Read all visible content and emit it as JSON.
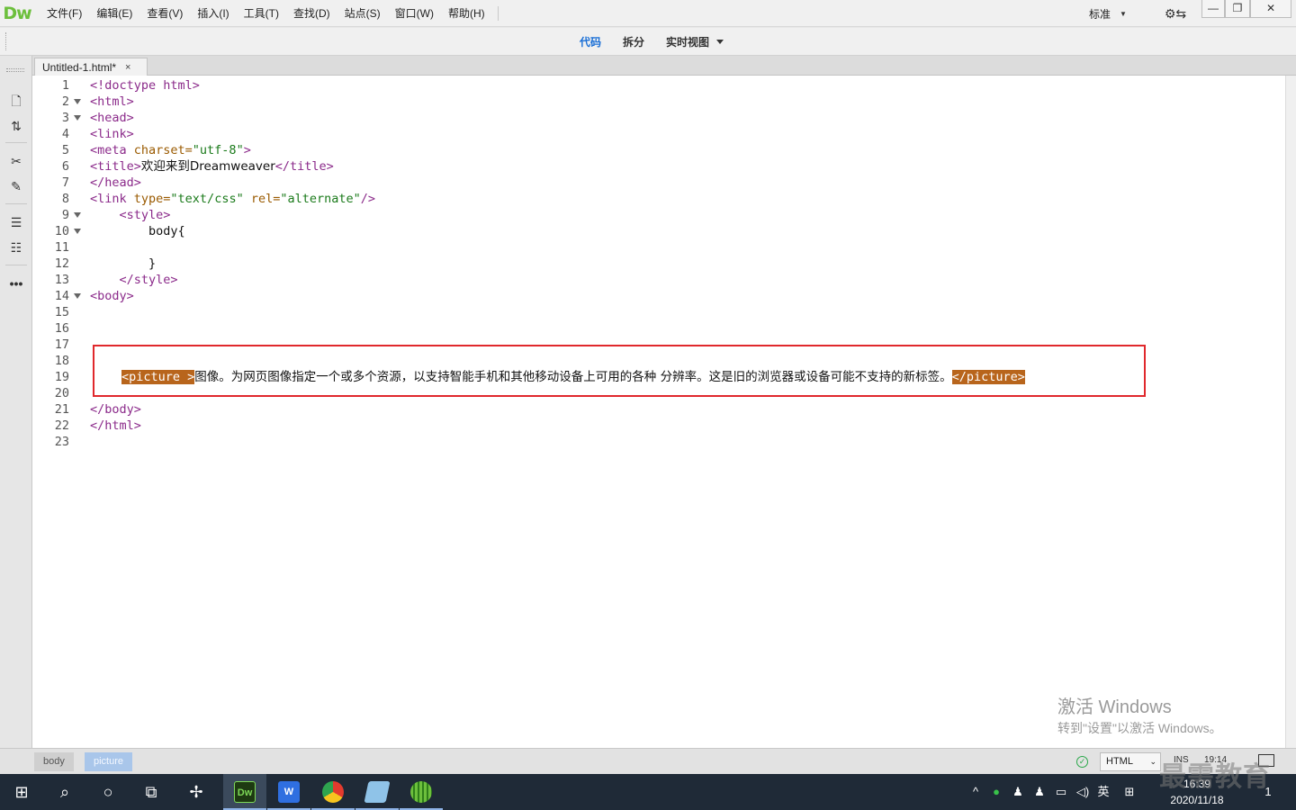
{
  "app": {
    "logo": "Dw"
  },
  "menu": [
    "文件(F)",
    "编辑(E)",
    "查看(V)",
    "插入(I)",
    "工具(T)",
    "查找(D)",
    "站点(S)",
    "窗口(W)",
    "帮助(H)"
  ],
  "workspace": {
    "label": "标准"
  },
  "window_buttons": {
    "minimize": "—",
    "restore": "❐",
    "close": "✕"
  },
  "view_tabs": [
    {
      "label": "代码",
      "active": true
    },
    {
      "label": "拆分",
      "active": false
    },
    {
      "label": "实时视图",
      "active": false
    }
  ],
  "document_tab": {
    "title": "Untitled-1.html*",
    "close": "×"
  },
  "code": {
    "line_numbers": [
      "1",
      "2",
      "3",
      "4",
      "5",
      "6",
      "7",
      "8",
      "9",
      "10",
      "11",
      "12",
      "13",
      "14",
      "15",
      "16",
      "17",
      "18",
      "19",
      "20",
      "21",
      "22",
      "23"
    ],
    "l1": "<!doctype html>",
    "l2": "<html>",
    "l3": "<head>",
    "l4": "<link>",
    "l5_tag": "<meta",
    "l5_attr": " charset=",
    "l5_str": "\"utf-8\"",
    "l5_end": ">",
    "l6_open": "<title>",
    "l6_text": "欢迎来到Dreamweaver",
    "l6_close": "</title>",
    "l7": "</head>",
    "l8_tag": "<link",
    "l8_attr1": " type=",
    "l8_str1": "\"text/css\"",
    "l8_attr2": " rel=",
    "l8_str2": "\"alternate\"",
    "l8_end": "/>",
    "l9": "    <style>",
    "l10": "        body{",
    "l12": "        }",
    "l13": "    </style>",
    "l14": "<body>",
    "l19_open": "<picture >",
    "l19_text": "图像。为网页图像指定一个或多个资源，以支持智能手机和其他移动设备上可用的各种 分辨率。这是旧的浏览器或设备可能不支持的新标签。",
    "l19_close": "</picture>",
    "l21": "</body>",
    "l22": "</html>"
  },
  "watermark": {
    "line1": "激活 Windows",
    "line2": "转到\"设置\"以激活 Windows。"
  },
  "status": {
    "breadcrumbs": [
      "body",
      "picture"
    ],
    "doc_type": "HTML",
    "mode": "INS",
    "position": "19:14"
  },
  "taskbar": {
    "dw_label": "Dw",
    "wps_label": "W",
    "ime": "英",
    "time": "16:39",
    "date": "2020/11/18",
    "notifications": "1"
  },
  "brand_watermark": "最需教育",
  "colors": {
    "accent": "#1a6fd6",
    "tag_highlight": "#b8651c",
    "highlight_box": "#e0282c",
    "dw_green": "#6cbf3c"
  }
}
